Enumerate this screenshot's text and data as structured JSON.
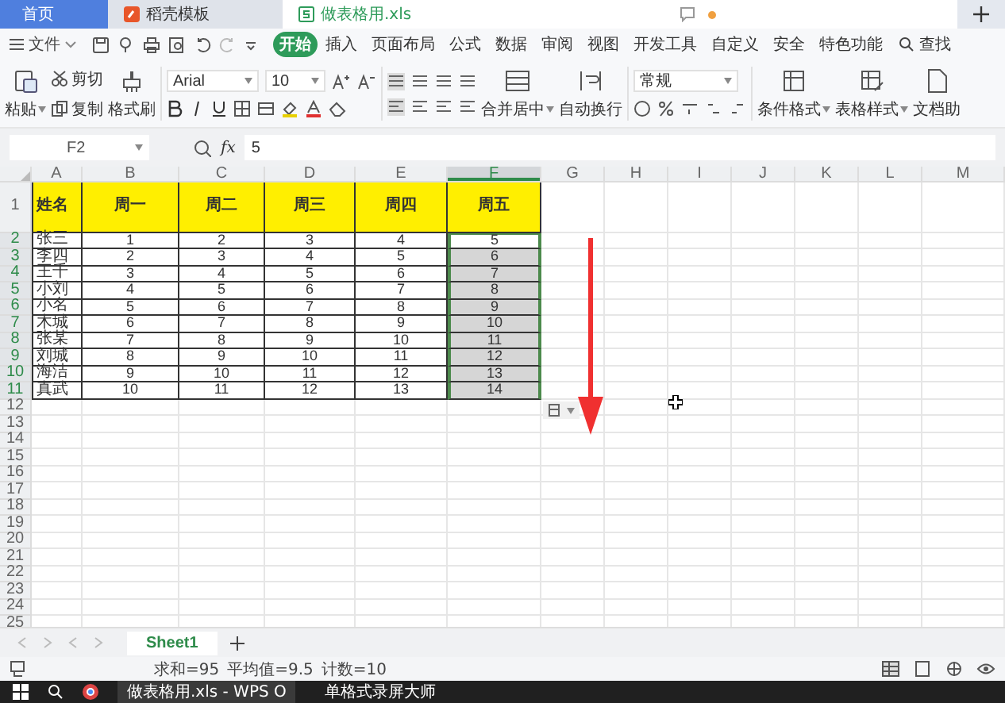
{
  "tabs": [
    {
      "label": "首页",
      "selected": false,
      "kind": "home"
    },
    {
      "label": "稻壳模板",
      "selected": false,
      "kind": "template"
    },
    {
      "label": "做表格用.xls",
      "selected": true,
      "kind": "sheet"
    }
  ],
  "menu": {
    "file": "文件",
    "items": [
      {
        "label": "开始",
        "selected": true
      },
      {
        "label": "插入",
        "selected": false
      },
      {
        "label": "页面布局",
        "selected": false
      },
      {
        "label": "公式",
        "selected": false
      },
      {
        "label": "数据",
        "selected": false
      },
      {
        "label": "审阅",
        "selected": false
      },
      {
        "label": "视图",
        "selected": false
      },
      {
        "label": "开发工具",
        "selected": false
      },
      {
        "label": "自定义",
        "selected": false
      },
      {
        "label": "安全",
        "selected": false
      },
      {
        "label": "特色功能",
        "selected": false
      }
    ],
    "search": "查找"
  },
  "ribbon": {
    "paste": "粘贴",
    "cut": "剪切",
    "copy": "复制",
    "format_painter": "格式刷",
    "font": "Arial",
    "size": "10",
    "merge": "合并居中",
    "wrap": "自动换行",
    "number_format": "常规",
    "conditional": "条件格式",
    "table_style": "表格样式",
    "assistant": "文档助"
  },
  "formula_bar": {
    "cell": "F2",
    "function_label": "fx",
    "value": "5"
  },
  "columns": [
    {
      "label": "A",
      "selected": false
    },
    {
      "label": "B",
      "selected": false
    },
    {
      "label": "C",
      "selected": false
    },
    {
      "label": "D",
      "selected": false
    },
    {
      "label": "E",
      "selected": false
    },
    {
      "label": "F",
      "selected": true
    },
    {
      "label": "G",
      "selected": false
    },
    {
      "label": "H",
      "selected": false
    },
    {
      "label": "I",
      "selected": false
    },
    {
      "label": "J",
      "selected": false
    },
    {
      "label": "K",
      "selected": false
    },
    {
      "label": "L",
      "selected": false
    },
    {
      "label": "M",
      "selected": false
    }
  ],
  "rows": [
    {
      "number": "1",
      "kind": "header",
      "selected": false,
      "cells": [
        {
          "text": "姓名",
          "selected": false,
          "active": false
        },
        {
          "text": "周一",
          "selected": false,
          "active": false
        },
        {
          "text": "周二",
          "selected": false,
          "active": false
        },
        {
          "text": "周三",
          "selected": false,
          "active": false
        },
        {
          "text": "周四",
          "selected": false,
          "active": false
        },
        {
          "text": "周五",
          "selected": false,
          "active": false
        }
      ]
    },
    {
      "number": "2",
      "kind": "data",
      "selected": true,
      "cells": [
        {
          "text": "张三",
          "selected": false,
          "active": false
        },
        {
          "text": "1",
          "selected": false,
          "active": false
        },
        {
          "text": "2",
          "selected": false,
          "active": false
        },
        {
          "text": "3",
          "selected": false,
          "active": false
        },
        {
          "text": "4",
          "selected": false,
          "active": false
        },
        {
          "text": "5",
          "selected": true,
          "active": true
        }
      ]
    },
    {
      "number": "3",
      "kind": "data",
      "selected": true,
      "cells": [
        {
          "text": "李四",
          "selected": false,
          "active": false
        },
        {
          "text": "2",
          "selected": false,
          "active": false
        },
        {
          "text": "3",
          "selected": false,
          "active": false
        },
        {
          "text": "4",
          "selected": false,
          "active": false
        },
        {
          "text": "5",
          "selected": false,
          "active": false
        },
        {
          "text": "6",
          "selected": true,
          "active": false
        }
      ]
    },
    {
      "number": "4",
      "kind": "data",
      "selected": true,
      "cells": [
        {
          "text": "王千",
          "selected": false,
          "active": false
        },
        {
          "text": "3",
          "selected": false,
          "active": false
        },
        {
          "text": "4",
          "selected": false,
          "active": false
        },
        {
          "text": "5",
          "selected": false,
          "active": false
        },
        {
          "text": "6",
          "selected": false,
          "active": false
        },
        {
          "text": "7",
          "selected": true,
          "active": false
        }
      ]
    },
    {
      "number": "5",
      "kind": "data",
      "selected": true,
      "cells": [
        {
          "text": "小刘",
          "selected": false,
          "active": false
        },
        {
          "text": "4",
          "selected": false,
          "active": false
        },
        {
          "text": "5",
          "selected": false,
          "active": false
        },
        {
          "text": "6",
          "selected": false,
          "active": false
        },
        {
          "text": "7",
          "selected": false,
          "active": false
        },
        {
          "text": "8",
          "selected": true,
          "active": false
        }
      ]
    },
    {
      "number": "6",
      "kind": "data",
      "selected": true,
      "cells": [
        {
          "text": "小名",
          "selected": false,
          "active": false
        },
        {
          "text": "5",
          "selected": false,
          "active": false
        },
        {
          "text": "6",
          "selected": false,
          "active": false
        },
        {
          "text": "7",
          "selected": false,
          "active": false
        },
        {
          "text": "8",
          "selected": false,
          "active": false
        },
        {
          "text": "9",
          "selected": true,
          "active": false
        }
      ]
    },
    {
      "number": "7",
      "kind": "data",
      "selected": true,
      "cells": [
        {
          "text": "木城",
          "selected": false,
          "active": false
        },
        {
          "text": "6",
          "selected": false,
          "active": false
        },
        {
          "text": "7",
          "selected": false,
          "active": false
        },
        {
          "text": "8",
          "selected": false,
          "active": false
        },
        {
          "text": "9",
          "selected": false,
          "active": false
        },
        {
          "text": "10",
          "selected": true,
          "active": false
        }
      ]
    },
    {
      "number": "8",
      "kind": "data",
      "selected": true,
      "cells": [
        {
          "text": "张某",
          "selected": false,
          "active": false
        },
        {
          "text": "7",
          "selected": false,
          "active": false
        },
        {
          "text": "8",
          "selected": false,
          "active": false
        },
        {
          "text": "9",
          "selected": false,
          "active": false
        },
        {
          "text": "10",
          "selected": false,
          "active": false
        },
        {
          "text": "11",
          "selected": true,
          "active": false
        }
      ]
    },
    {
      "number": "9",
      "kind": "data",
      "selected": true,
      "cells": [
        {
          "text": "刘城",
          "selected": false,
          "active": false
        },
        {
          "text": "8",
          "selected": false,
          "active": false
        },
        {
          "text": "9",
          "selected": false,
          "active": false
        },
        {
          "text": "10",
          "selected": false,
          "active": false
        },
        {
          "text": "11",
          "selected": false,
          "active": false
        },
        {
          "text": "12",
          "selected": true,
          "active": false
        }
      ]
    },
    {
      "number": "10",
      "kind": "data",
      "selected": true,
      "cells": [
        {
          "text": "海洁",
          "selected": false,
          "active": false
        },
        {
          "text": "9",
          "selected": false,
          "active": false
        },
        {
          "text": "10",
          "selected": false,
          "active": false
        },
        {
          "text": "11",
          "selected": false,
          "active": false
        },
        {
          "text": "12",
          "selected": false,
          "active": false
        },
        {
          "text": "13",
          "selected": true,
          "active": false
        }
      ]
    },
    {
      "number": "11",
      "kind": "data",
      "selected": true,
      "cells": [
        {
          "text": "真武",
          "selected": false,
          "active": false
        },
        {
          "text": "10",
          "selected": false,
          "active": false
        },
        {
          "text": "11",
          "selected": false,
          "active": false
        },
        {
          "text": "12",
          "selected": false,
          "active": false
        },
        {
          "text": "13",
          "selected": false,
          "active": false
        },
        {
          "text": "14",
          "selected": true,
          "active": false
        }
      ]
    },
    {
      "number": "12",
      "kind": "empty",
      "selected": false
    },
    {
      "number": "13",
      "kind": "empty",
      "selected": false
    },
    {
      "number": "14",
      "kind": "empty",
      "selected": false
    },
    {
      "number": "15",
      "kind": "empty",
      "selected": false
    },
    {
      "number": "16",
      "kind": "empty",
      "selected": false
    },
    {
      "number": "17",
      "kind": "empty",
      "selected": false
    },
    {
      "number": "18",
      "kind": "empty",
      "selected": false
    },
    {
      "number": "19",
      "kind": "empty",
      "selected": false
    },
    {
      "number": "20",
      "kind": "empty",
      "selected": false
    },
    {
      "number": "21",
      "kind": "empty",
      "selected": false
    },
    {
      "number": "22",
      "kind": "empty",
      "selected": false
    },
    {
      "number": "23",
      "kind": "empty",
      "selected": false
    },
    {
      "number": "24",
      "kind": "empty",
      "selected": false
    },
    {
      "number": "25",
      "kind": "empty",
      "selected": false
    }
  ],
  "sheets": [
    {
      "label": "Sheet1",
      "selected": true
    }
  ],
  "status": [
    "求和=95",
    "平均值=9.5",
    "计数=10"
  ],
  "taskbar": [
    "做表格用.xls - WPS O",
    "单格式录屏大师"
  ]
}
